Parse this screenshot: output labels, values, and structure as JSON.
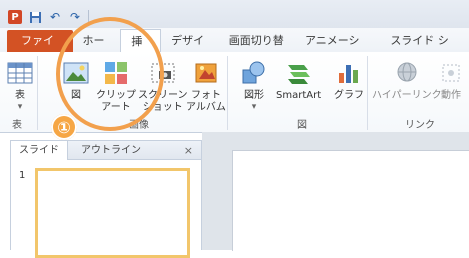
{
  "quick_access": {
    "app_badge": "P",
    "save_icon": "save-icon",
    "undo_icon": "undo-icon",
    "redo_icon": "redo-icon"
  },
  "tabs": [
    {
      "label": "ファイル",
      "kind": "file"
    },
    {
      "label": "ホーム"
    },
    {
      "label": "挿入",
      "active": true
    },
    {
      "label": "デザイン"
    },
    {
      "label": "画面切り替え"
    },
    {
      "label": "アニメーション"
    },
    {
      "label": "スライド ショー"
    }
  ],
  "ribbon": {
    "table": {
      "label": "表",
      "group": "表"
    },
    "picture": {
      "label": "図"
    },
    "clipart": {
      "line1": "クリップ",
      "line2": "アート"
    },
    "screenshot": {
      "line1": "スクリーン",
      "line2": "ショット"
    },
    "album": {
      "line1": "フォト",
      "line2": "アルバム"
    },
    "images_group": "画像",
    "shapes": {
      "label": "図形"
    },
    "smartart": {
      "label": "SmartArt"
    },
    "chart": {
      "label": "グラフ"
    },
    "illustrations_group": "図",
    "hyperlink": {
      "label": "ハイパーリンク"
    },
    "action": {
      "label": "動作"
    },
    "links_group": "リンク"
  },
  "panel": {
    "tab_slides": "スライド",
    "tab_outline": "アウトライン",
    "close": "×",
    "slide_number": "1"
  },
  "annotation": {
    "badge": "①",
    "color": "#f2a04d"
  },
  "colors": {
    "file_tab": "#d35224",
    "accent": "#2a62a8",
    "selected_slide_border": "#f2c66b"
  }
}
